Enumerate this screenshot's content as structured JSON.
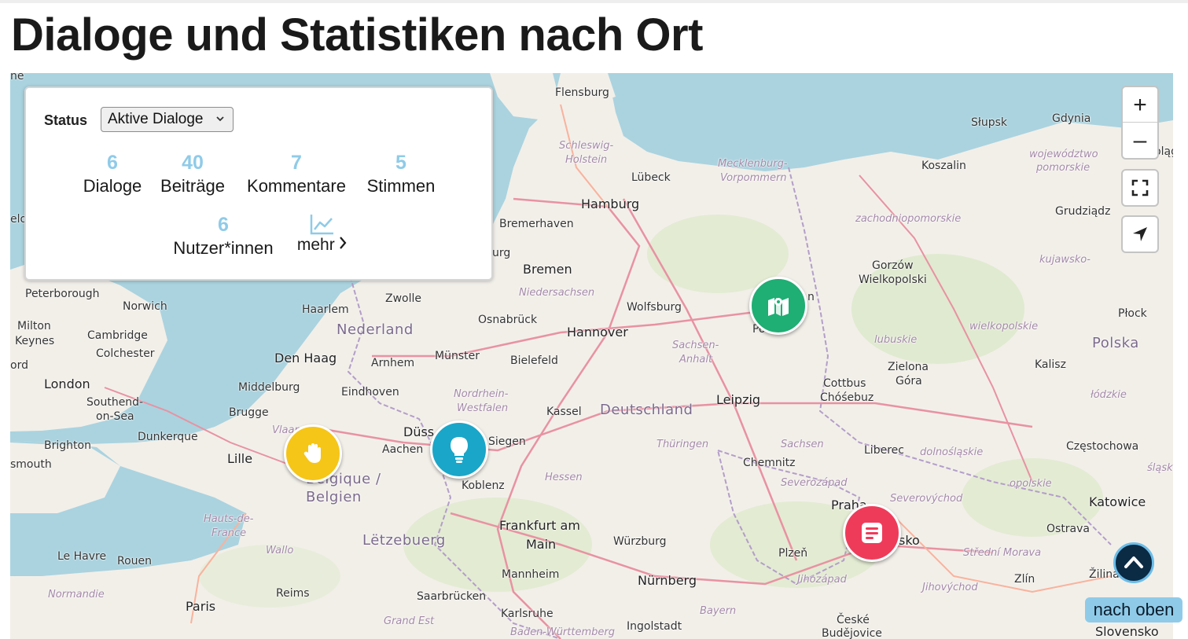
{
  "page": {
    "title": "Dialoge und Statistiken nach Ort"
  },
  "panel": {
    "status_label": "Status",
    "status_select": {
      "value": "Aktive Dialoge"
    },
    "stats": [
      {
        "value": "6",
        "label": "Dialoge"
      },
      {
        "value": "40",
        "label": "Beiträge"
      },
      {
        "value": "7",
        "label": "Kommentare"
      },
      {
        "value": "5",
        "label": "Stimmen"
      },
      {
        "value": "6",
        "label": "Nutzer*innen"
      }
    ],
    "more_label": "mehr",
    "more_icon": "chart-line-icon"
  },
  "map_controls": {
    "zoom_in": "+",
    "zoom_out": "–",
    "fullscreen_icon": "fullscreen-icon",
    "locate_icon": "location-arrow-icon"
  },
  "markers": [
    {
      "name": "marker-participation",
      "icon": "hand-icon",
      "color": "#f5c518"
    },
    {
      "name": "marker-idea",
      "icon": "lightbulb-icon",
      "color": "#1aa6c8"
    },
    {
      "name": "marker-map",
      "icon": "map-icon",
      "color": "#1fae74"
    },
    {
      "name": "marker-text",
      "icon": "text-document-icon",
      "color": "#ef3b5a"
    }
  ],
  "map_labels": {
    "cities": [
      "Flensburg",
      "Lübeck",
      "Hamburg",
      "Bremerhaven",
      "Bremen",
      "Wolfsburg",
      "Hannover",
      "Osnabrück",
      "Bielefeld",
      "Münster",
      "Zwolle",
      "Haarlem",
      "Den Haag",
      "Arnhem",
      "Eindhoven",
      "Middelburg",
      "Brugge",
      "Dunkerque",
      "Lille",
      "Düss",
      "Aachen",
      "Siegen",
      "Kassel",
      "Koblenz",
      "Frankfurt am",
      "Main",
      "Würzburg",
      "Mannheim",
      "Nürnberg",
      "Karlsruhe",
      "Ingolstadt",
      "Saarbrücken",
      "Reims",
      "Paris",
      "Rouen",
      "Le Havre",
      "Leipzig",
      "Chemnitz",
      "Cottbus",
      "Chóśebuz",
      "Po",
      "n",
      "Gorzów",
      "Wielkopolski",
      "Zielona",
      "Góra",
      "Liberec",
      "Praha",
      "Plzeň",
      "sko",
      "České",
      "Budějovice",
      "Ostrava",
      "Žilina",
      "Zlín",
      "Katowice",
      "Częstochowa",
      "Kalisz",
      "Płock",
      "Grudziądz",
      "Koszalin",
      "Słupsk",
      "Gdynia",
      "Elbląg",
      "London",
      "Southend-",
      "on-Sea",
      "Colchester",
      "Cambridge",
      "Milton",
      "Keynes",
      "Peterborough",
      "Norwich",
      "Brighton",
      "smouth",
      "ord",
      "elo",
      "he",
      "urg",
      "Slovensko"
    ],
    "countries": [
      "Nederland",
      "Deutschland",
      "Belgique /",
      "Belgien",
      "Lëtzebuerg",
      "Polska"
    ],
    "regions": [
      "Schleswig-",
      "Holstein",
      "Mecklenburg-",
      "Vorpommern",
      "Niedersachsen",
      "Sachsen-",
      "Anhalt",
      "Nordrhein-",
      "Westfalen",
      "Hessen",
      "Thüringen",
      "Sachsen",
      "Severozápad",
      "Severovýchod",
      "Jihozápad",
      "Jihovýchod",
      "Střední Morava",
      "Hauts-de-",
      "France",
      "Normandie",
      "Grand Est",
      "Baden-Württemberg",
      "Bayern",
      "Vlaan",
      "województwo",
      "pomorskie",
      "zachodniopomorskie",
      "kujawsko-",
      "wielkopolskie",
      "lubuskie",
      "łódzkie",
      "dolnośląskie",
      "opolskie",
      "śląskie",
      "Wallo"
    ]
  },
  "back_to_top": {
    "label": "nach oben",
    "icon": "chevron-up-icon"
  },
  "colors": {
    "accent": "#8fcbe8",
    "water": "#aad3df",
    "land": "#f2efe9"
  }
}
